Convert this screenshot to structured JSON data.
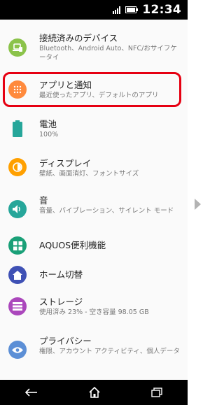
{
  "status_bar": {
    "time": "12:34"
  },
  "settings": [
    {
      "title": "接続済みのデバイス",
      "subtitle": "Bluetooth、Android Auto、NFC/おサイフケータイ",
      "icon": "connected-devices-icon",
      "color": "#8bc34a"
    },
    {
      "title": "アプリと通知",
      "subtitle": "最近使ったアプリ、デフォルトのアプリ",
      "icon": "apps-grid-icon",
      "color": "#ff8a3d"
    },
    {
      "title": "電池",
      "subtitle": "100%",
      "icon": "battery-icon",
      "color": "#26a69a"
    },
    {
      "title": "ディスプレイ",
      "subtitle": "壁紙、画面消灯、フォントサイズ",
      "icon": "brightness-icon",
      "color": "#ffa000"
    },
    {
      "title": "音",
      "subtitle": "音量、バイブレーション、サイレント モード",
      "icon": "volume-icon",
      "color": "#26a69a"
    },
    {
      "title": "AQUOS便利機能",
      "subtitle": "",
      "icon": "aquos-grid-icon",
      "color": "#1aa078"
    },
    {
      "title": "ホーム切替",
      "subtitle": "",
      "icon": "home-icon",
      "color": "#3f51b5"
    },
    {
      "title": "ストレージ",
      "subtitle": "使用済み 23% - 空き容量 98.05 GB",
      "icon": "storage-icon",
      "color": "#ab47bc"
    },
    {
      "title": "プライバシー",
      "subtitle": "権限、アカウント アクティビティ、個人データ",
      "icon": "privacy-eye-icon",
      "color": "#5c8fd6"
    }
  ],
  "highlight_color": "#e60012"
}
